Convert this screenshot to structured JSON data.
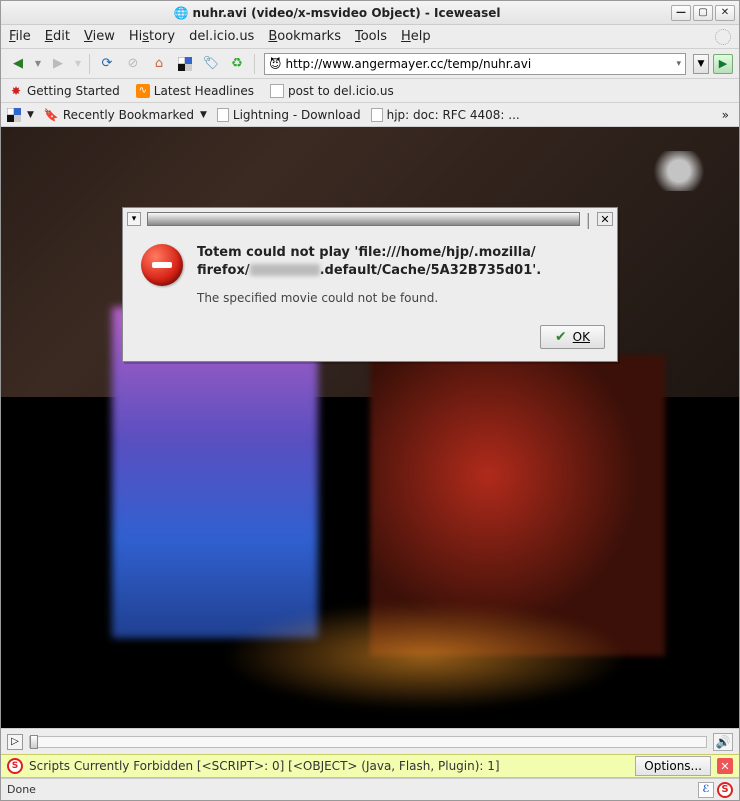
{
  "window": {
    "title": "nuhr.avi (video/x-msvideo Object) - Iceweasel"
  },
  "menu": {
    "file": "File",
    "edit": "Edit",
    "view": "View",
    "history": "History",
    "delicious": "del.icio.us",
    "bookmarks": "Bookmarks",
    "tools": "Tools",
    "help": "Help"
  },
  "url": {
    "value": "http://www.angermayer.cc/temp/nuhr.avi"
  },
  "bookmarks_toolbar": {
    "getting_started": "Getting Started",
    "latest_headlines": "Latest Headlines",
    "post_delicious": "post to del.icio.us"
  },
  "recent_bar": {
    "recently": "Recently Bookmarked",
    "lightning": "Lightning - Download",
    "hjp": "hjp: doc: RFC 4408: ..."
  },
  "dialog": {
    "line1a": "Totem could not play 'file:///home/hjp/.mozilla/",
    "line1b_prefix": "firefox/",
    "line1b_suffix": ".default/Cache/5A32B735d01'.",
    "line2": "The specified movie could not be found.",
    "ok": "OK"
  },
  "noscript": {
    "text": "Scripts Currently Forbidden [<SCRIPT>: 0] [<OBJECT> (Java, Flash, Plugin): 1]",
    "options": "Options..."
  },
  "status": {
    "text": "Done"
  }
}
